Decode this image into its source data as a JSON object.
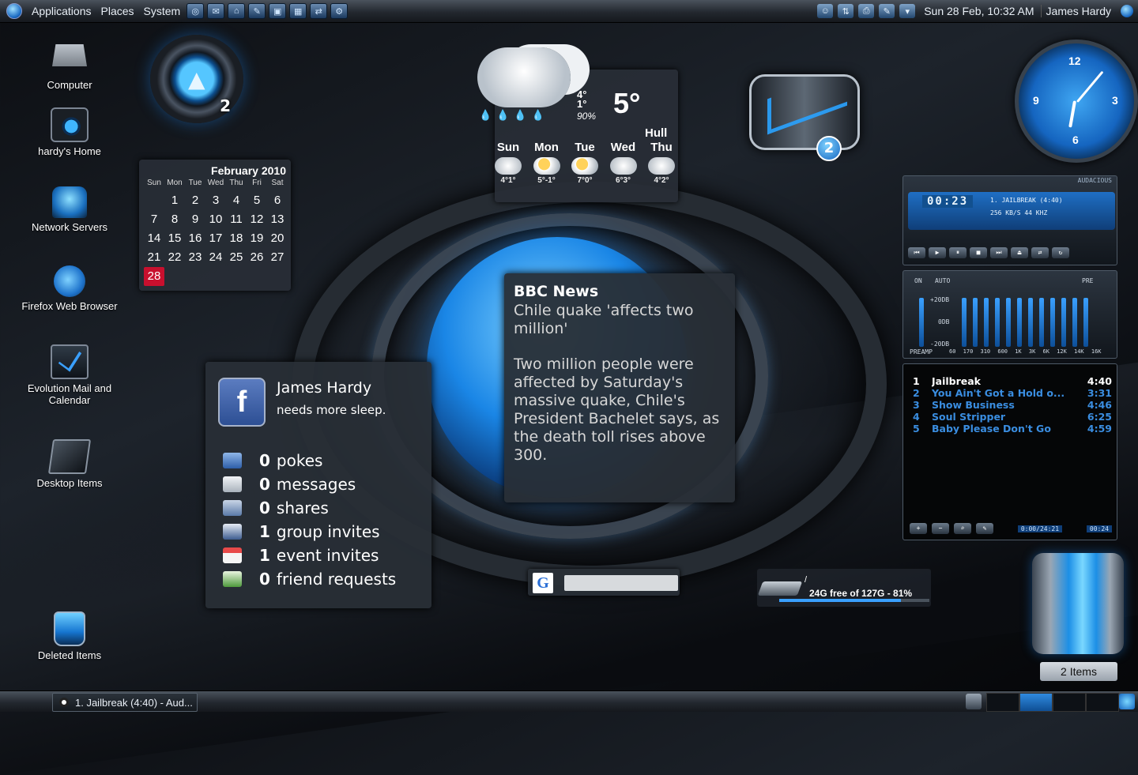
{
  "top_panel": {
    "menus": [
      "Applications",
      "Places",
      "System"
    ],
    "datetime": "Sun 28 Feb, 10:32 AM",
    "user": "James Hardy"
  },
  "desktop_icons": [
    {
      "label": "Computer",
      "icon": "computer-icon"
    },
    {
      "label": "hardy's Home",
      "icon": "home-folder-icon"
    },
    {
      "label": "Network Servers",
      "icon": "network-icon"
    },
    {
      "label": "Firefox Web Browser",
      "icon": "firefox-icon"
    },
    {
      "label": "Evolution Mail and Calendar",
      "icon": "mail-icon"
    },
    {
      "label": "Desktop Items",
      "icon": "folder-icon"
    },
    {
      "label": "Deleted Items",
      "icon": "trash-icon"
    }
  ],
  "orb_widget": {
    "number": "2"
  },
  "calendar": {
    "title": "February 2010",
    "weekdays": [
      "Sun",
      "Mon",
      "Tue",
      "Wed",
      "Thu",
      "Fri",
      "Sat"
    ],
    "days": [
      "",
      "1",
      "2",
      "3",
      "4",
      "5",
      "6",
      "7",
      "8",
      "9",
      "10",
      "11",
      "12",
      "13",
      "14",
      "15",
      "16",
      "17",
      "18",
      "19",
      "20",
      "21",
      "22",
      "23",
      "24",
      "25",
      "26",
      "27",
      "28"
    ],
    "today": "28"
  },
  "weather": {
    "high": "4°",
    "low": "1°",
    "humidity": "90%",
    "temperature": "5°",
    "city": "Hull",
    "forecast": [
      {
        "day": "Sun",
        "range": "4°1°",
        "icon": "rain-cloud-icon"
      },
      {
        "day": "Mon",
        "range": "5°-1°",
        "icon": "sun-cloud-icon"
      },
      {
        "day": "Tue",
        "range": "7°0°",
        "icon": "sun-cloud-icon"
      },
      {
        "day": "Wed",
        "range": "6°3°",
        "icon": "cloud-icon"
      },
      {
        "day": "Thu",
        "range": "4°2°",
        "icon": "rain-cloud-icon"
      }
    ]
  },
  "mail_widget": {
    "unread": "2"
  },
  "clock": {
    "numbers": [
      "12",
      "3",
      "6",
      "9"
    ]
  },
  "bbc_news": {
    "source": "BBC News",
    "headline": "Chile quake 'affects two million'",
    "body": "Two million people were affected by Saturday's massive quake, Chile's President Bachelet says, as the death toll rises above 300."
  },
  "facebook": {
    "name": "James Hardy",
    "status": "needs more sleep.",
    "notifications": [
      {
        "count": "0",
        "label": "pokes",
        "icon": "poke-icon"
      },
      {
        "count": "0",
        "label": "messages",
        "icon": "envelope-icon"
      },
      {
        "count": "0",
        "label": "shares",
        "icon": "share-icon"
      },
      {
        "count": "1",
        "label": "group invites",
        "icon": "group-icon"
      },
      {
        "count": "1",
        "label": "event invites",
        "icon": "calendar-icon"
      },
      {
        "count": "0",
        "label": "friend requests",
        "icon": "friend-icon"
      }
    ]
  },
  "google_search": {
    "logo": "G",
    "placeholder": ""
  },
  "disk_usage": {
    "mount": "/",
    "text": "24G free of 127G - 81%",
    "used_percent": 81
  },
  "audacious": {
    "title": "AUDACIOUS",
    "time": "00:23",
    "track": "1. JAILBREAK (4:40)",
    "bitrate": "256 KB/S",
    "samplerate": "44 KHZ",
    "eq_on": "ON",
    "eq_auto": "AUTO",
    "eq_pre": "PRE",
    "eq_preamp": "PREAMP",
    "eq_db": [
      "+20DB",
      "0DB",
      "-20DB"
    ],
    "eq_freqs": "60 170 310 600 1K 3K 6K 12K 14K 16K",
    "playlist": [
      {
        "num": "1",
        "title": "Jailbreak",
        "duration": "4:40"
      },
      {
        "num": "2",
        "title": "You Ain't Got a Hold o...",
        "duration": "3:31"
      },
      {
        "num": "3",
        "title": "Show Business",
        "duration": "4:46"
      },
      {
        "num": "4",
        "title": "Soul Stripper",
        "duration": "6:25"
      },
      {
        "num": "5",
        "title": "Baby Please Don't Go",
        "duration": "4:59"
      }
    ],
    "playlist_time": "0:00/24:21",
    "playlist_pos": "00:24"
  },
  "trash": {
    "label": "2 Items"
  },
  "taskbar": {
    "task": "1. Jailbreak (4:40) - Aud..."
  }
}
